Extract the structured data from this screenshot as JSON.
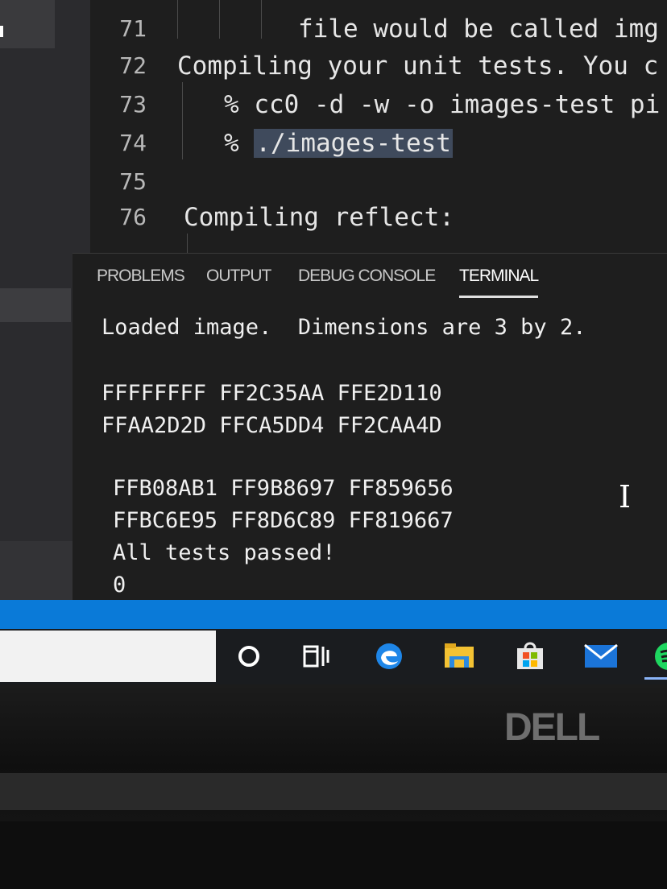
{
  "editor": {
    "lines": [
      {
        "num": "71",
        "text": "file would be called img"
      },
      {
        "num": "72",
        "text": "Compiling your unit tests. You c"
      },
      {
        "num": "73",
        "text": "% cc0 -d -w -o images-test pi"
      },
      {
        "num": "74",
        "prompt": "% ",
        "selected": "./images-test"
      },
      {
        "num": "75",
        "text": ""
      },
      {
        "num": "76",
        "text": "Compiling reflect:"
      }
    ]
  },
  "panel": {
    "tabs": [
      "PROBLEMS",
      "OUTPUT",
      "DEBUG CONSOLE",
      "TERMINAL"
    ],
    "active_tab": "TERMINAL",
    "terminal": [
      "Loaded image.  Dimensions are 3 by 2.",
      "FFFFFFFF FF2C35AA FFE2D110",
      "FFAA2D2D FFCA5DD4 FF2CAA4D",
      "FFB08AB1 FF9B8697 FF859656",
      "FFBC6E95 FF8D6C89 FF819667",
      "All tests passed!",
      "0"
    ]
  },
  "taskbar": {
    "icons": [
      "cortana-icon",
      "task-view-icon",
      "edge-icon",
      "file-explorer-icon",
      "store-icon",
      "mail-icon",
      "spotify-icon"
    ]
  },
  "bezel": {
    "logo": "DELL"
  },
  "colors": {
    "accent": "#0a7ad8",
    "editor_bg": "#1e1e1e",
    "selection": "#3f4a5c"
  }
}
